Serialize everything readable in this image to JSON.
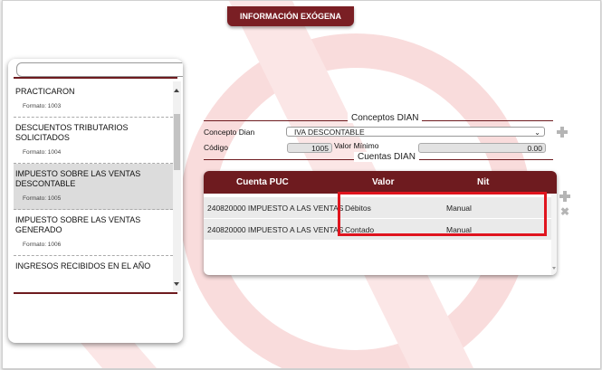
{
  "header": {
    "title": "INFORMACIÓN EXÓGENA"
  },
  "search": {
    "placeholder": ""
  },
  "list": {
    "items": [
      {
        "title": "PRACTICARON",
        "format": "Formato: 1003",
        "selected": false
      },
      {
        "title": "DESCUENTOS TRIBUTARIOS SOLICITADOS",
        "format": "Formato: 1004",
        "selected": false
      },
      {
        "title": "IMPUESTO SOBRE LAS VENTAS DESCONTABLE",
        "format": "Formato: 1005",
        "selected": true
      },
      {
        "title": "IMPUESTO SOBRE LAS VENTAS GENERADO",
        "format": "Formato: 1006",
        "selected": false
      },
      {
        "title": "INGRESOS RECIBIDOS EN EL AÑO",
        "format": "",
        "selected": false
      }
    ]
  },
  "conceptos": {
    "section_title": "Conceptos DIAN",
    "concepto_label": "Concepto Dian",
    "concepto_value": "IVA DESCONTABLE",
    "codigo_label": "Código",
    "codigo_value": "1005",
    "valor_minimo_label": "Valor Mínimo",
    "valor_minimo_value": "0.00"
  },
  "cuentas": {
    "section_title": "Cuentas DIAN",
    "columns": [
      "Cuenta PUC",
      "Valor",
      "Nit"
    ],
    "rows": [
      {
        "cuenta": "240820000 IMPUESTO A LAS VENTAS",
        "valor": "Débitos",
        "nit": "Manual"
      },
      {
        "cuenta": "240820000 IMPUESTO A LAS VENTAS",
        "valor": "Contado",
        "nit": "Manual"
      }
    ]
  },
  "colors": {
    "brand": "#6e1b1f",
    "highlight": "#e0141e",
    "watermark": "#f7d3d3"
  },
  "icons": {
    "add": "plus-icon",
    "remove": "close-icon",
    "dropdown": "chevron-down-icon"
  }
}
